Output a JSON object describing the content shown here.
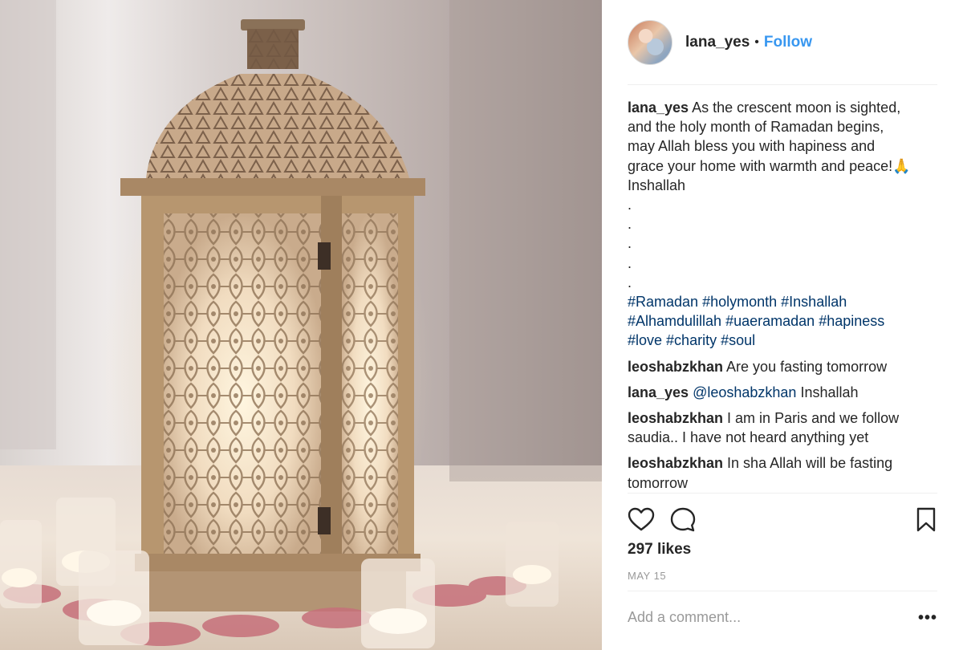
{
  "post": {
    "username": "lana_yes",
    "separator": "•",
    "follow_label": "Follow",
    "caption": {
      "author": "lana_yes",
      "lines": [
        "As the crescent moon is sighted,",
        "and the holy month of Ramadan begins,",
        "may Allah bless you with hapiness and",
        "grace your home with warmth and peace!🙏",
        "Inshallah"
      ],
      "dots": [
        ".",
        ".",
        ".",
        ".",
        "."
      ],
      "hashtag_lines": [
        [
          "#Ramadan",
          "#holymonth",
          "#Inshallah"
        ],
        [
          "#Alhamdulillah",
          "#uaeramadan",
          "#hapiness"
        ],
        [
          "#love",
          "#charity",
          "#soul"
        ]
      ]
    },
    "comments": [
      {
        "author": "leoshabzkhan",
        "text": "Are you fasting tomorrow"
      },
      {
        "author": "lana_yes",
        "mention": "@leoshabzkhan",
        "text": "Inshallah"
      },
      {
        "author": "leoshabzkhan",
        "text": "I am in Paris and we follow saudia.. I have not heard anything yet"
      },
      {
        "author": "leoshabzkhan",
        "text": "In sha Allah will be fasting tomorrow"
      }
    ],
    "likes": "297 likes",
    "date": "MAY 15",
    "comment_placeholder": "Add a comment...",
    "more_label": "•••"
  },
  "icons": {
    "like": "heart-icon",
    "comment": "comment-bubble-icon",
    "save": "bookmark-icon",
    "more": "more-options-icon"
  },
  "colors": {
    "text": "#262626",
    "link": "#003569",
    "follow": "#3897f0",
    "muted": "#999999",
    "divider": "#efefef"
  }
}
